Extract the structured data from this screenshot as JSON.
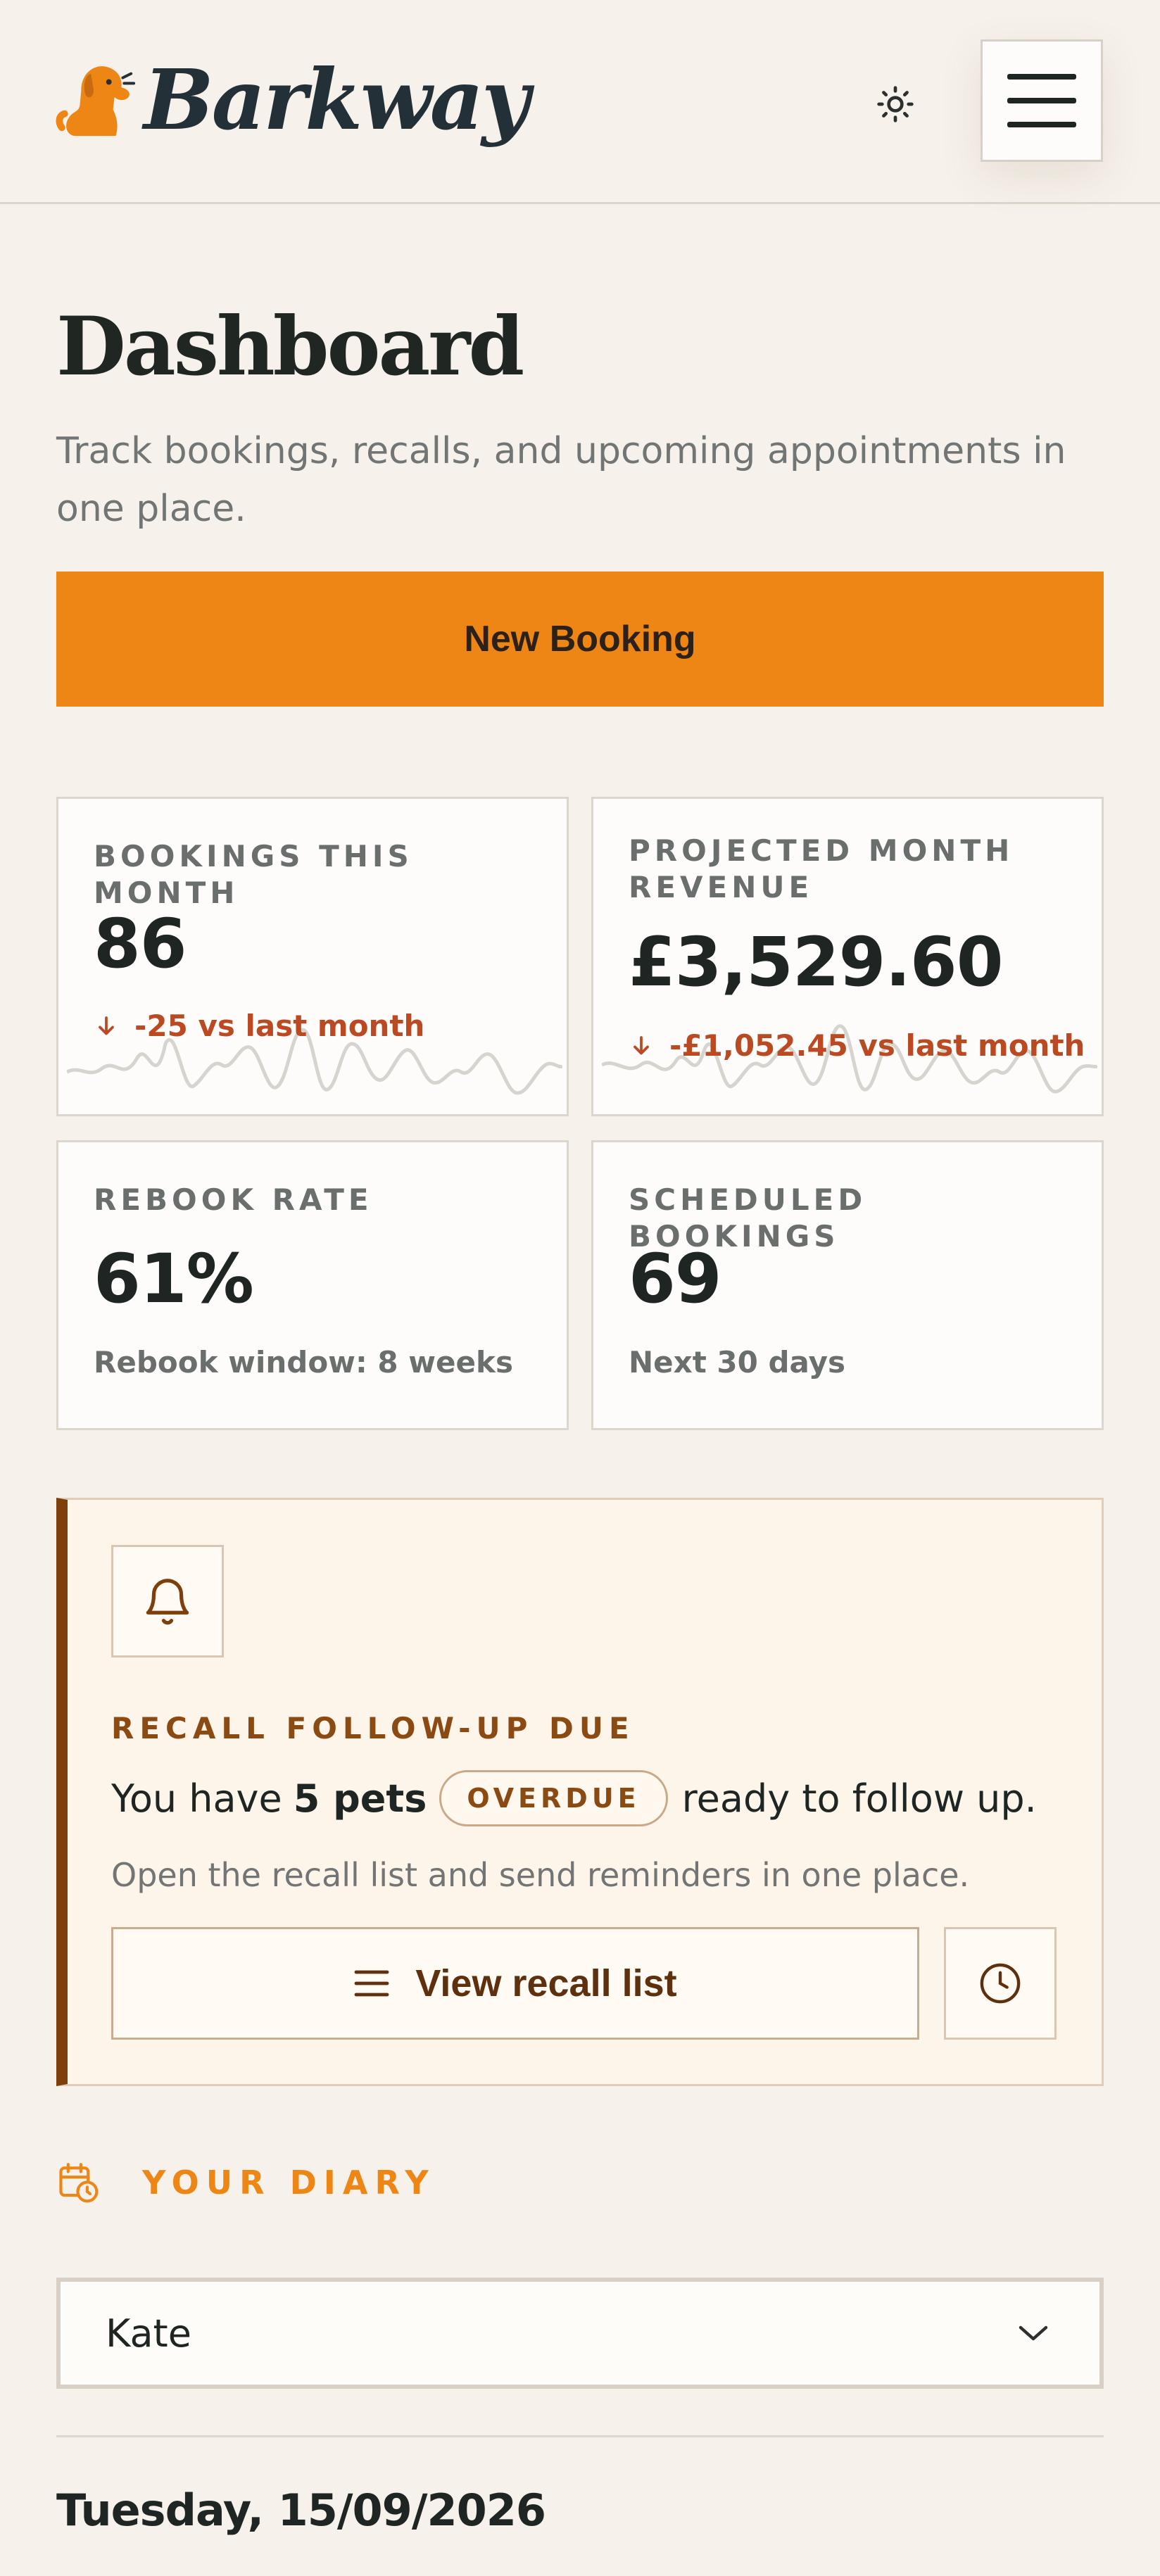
{
  "header": {
    "brand": "Barkway",
    "logo_icon": "dog-icon",
    "theme_icon": "sun-icon",
    "menu_icon": "hamburger-icon"
  },
  "page": {
    "title": "Dashboard",
    "subtitle": "Track bookings, recalls, and upcoming appointments in one place.",
    "new_booking_label": "New Booking"
  },
  "stats": {
    "bookings": {
      "label": "BOOKINGS THIS MONTH",
      "value": "86",
      "delta": "-25 vs last month"
    },
    "revenue": {
      "label": "PROJECTED MONTH REVENUE",
      "value": "£3,529.60",
      "delta": "-£1,052.45 vs last month"
    },
    "rebook": {
      "label": "REBOOK RATE",
      "value": "61%",
      "note": "Rebook window: 8 weeks"
    },
    "scheduled": {
      "label": "SCHEDULED BOOKINGS",
      "value": "69",
      "note": "Next 30 days"
    }
  },
  "recall": {
    "kicker": "RECALL FOLLOW-UP DUE",
    "prefix": "You have",
    "count": "5 pets",
    "badge": "OVERDUE",
    "suffix": "ready to follow up.",
    "description": "Open the recall list and send reminders in one place.",
    "button_label": "View recall list"
  },
  "diary": {
    "title": "YOUR DIARY",
    "selected_staff": "Kate",
    "date": "Tuesday, 15/09/2026"
  },
  "colors": {
    "accent": "#ee8615",
    "negative": "#bb4a22",
    "recall_border": "#7e3f0d"
  }
}
